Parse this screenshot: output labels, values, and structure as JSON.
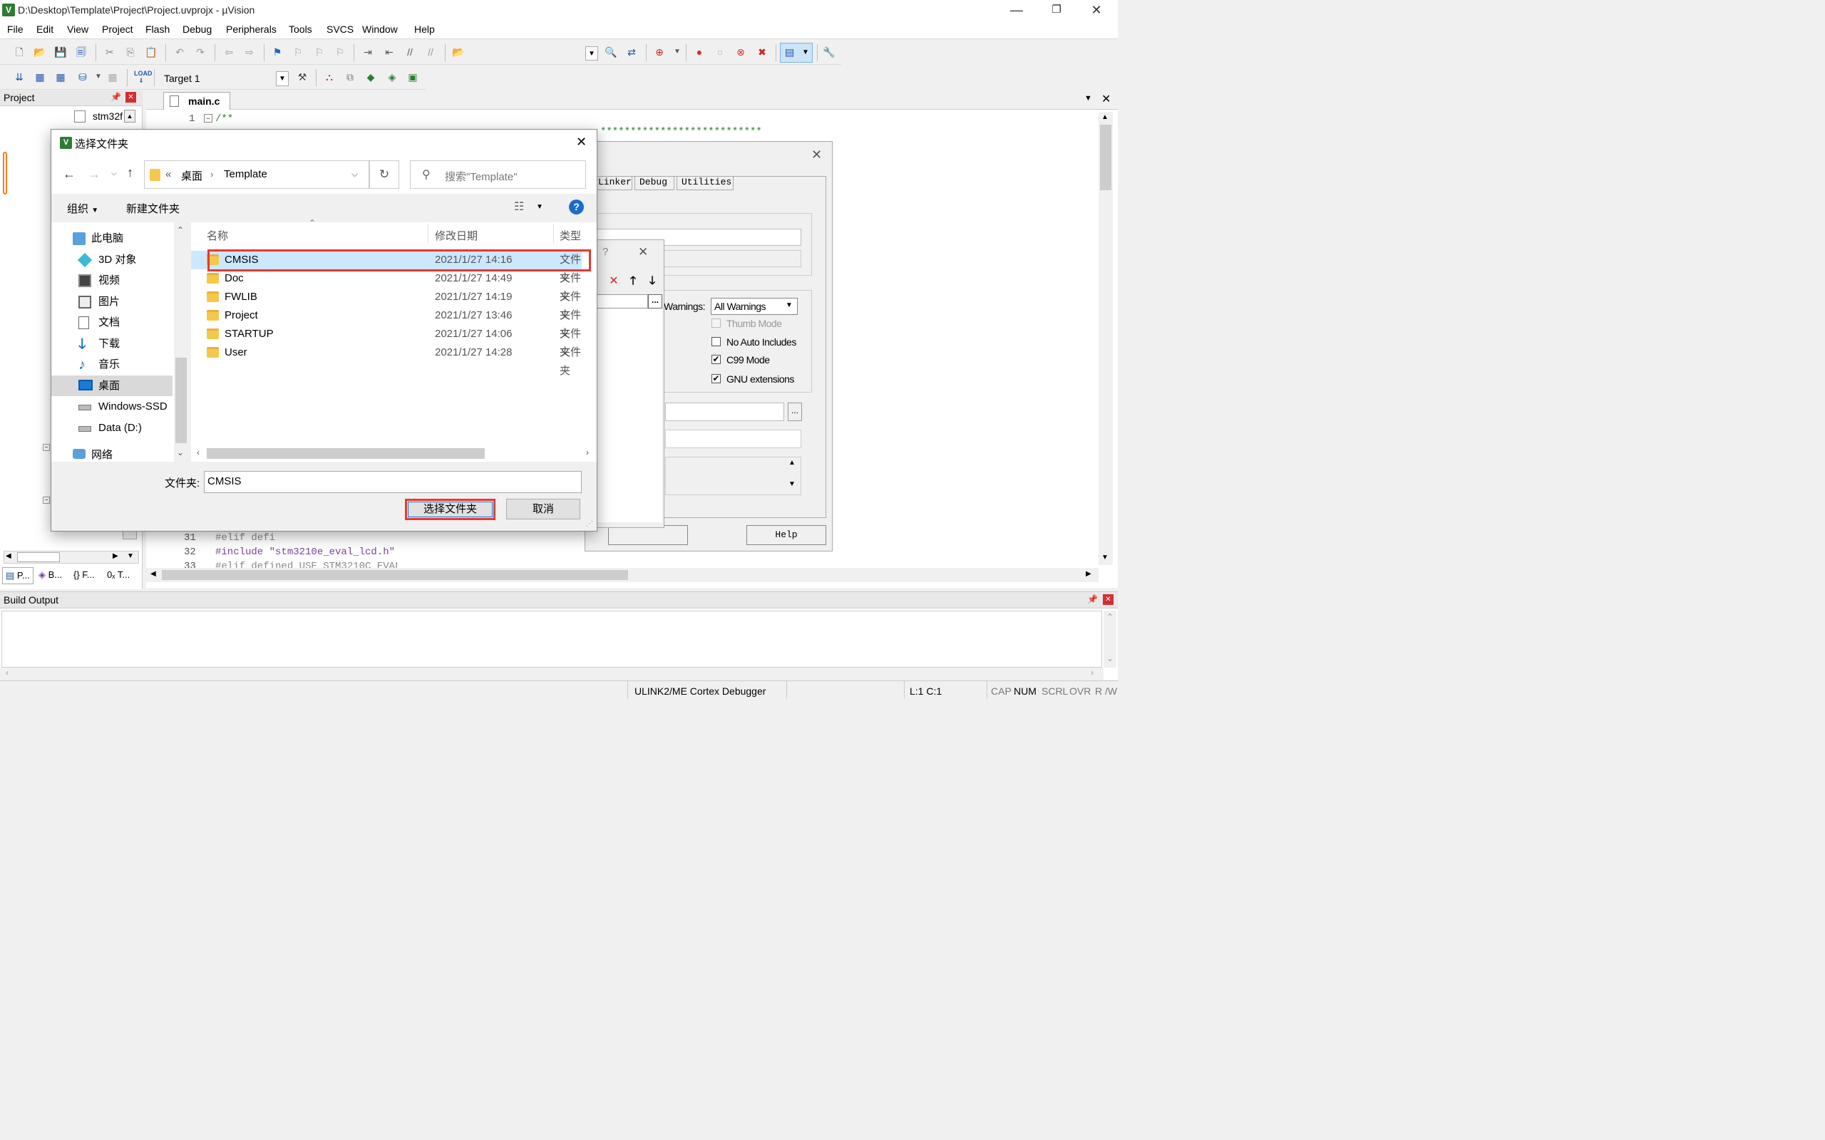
{
  "window": {
    "title": "D:\\Desktop\\Template\\Project\\Project.uvprojx - µVision",
    "app_icon": "V",
    "minimize": "—",
    "restore": "❐",
    "close": "✕"
  },
  "menu": [
    "File",
    "Edit",
    "View",
    "Project",
    "Flash",
    "Debug",
    "Peripherals",
    "Tools",
    "SVCS",
    "Window",
    "Help"
  ],
  "toolbar": {
    "target": "Target 1"
  },
  "project_panel": {
    "title": "Project",
    "tree_item": "stm32f",
    "bottom_tabs": [
      "P...",
      "B...",
      "{} F...",
      "0ₓ T..."
    ]
  },
  "editor": {
    "tab": "main.c",
    "lines": [
      {
        "num": "1",
        "code": "/**"
      },
      {
        "num": "31",
        "code": "#elif defi"
      },
      {
        "num": "32",
        "code": " #include \"stm3210e_eval_lcd.h\""
      },
      {
        "num": "33",
        "code": "#elif defined USE_STM3210C_EVAL"
      }
    ],
    "stars": "***************************"
  },
  "options_dialog": {
    "tabs": [
      "Linker",
      "Debug",
      "Utilities"
    ],
    "warnings_label": "Warnings:",
    "warnings_value": "All Warnings",
    "checkboxes": [
      {
        "label": "Thumb Mode",
        "checked": false,
        "disabled": true
      },
      {
        "label": "No Auto Includes",
        "checked": false,
        "disabled": false
      },
      {
        "label": "C99 Mode",
        "checked": true,
        "disabled": false
      },
      {
        "label": "GNU extensions",
        "checked": true,
        "disabled": false
      }
    ],
    "browse": "...",
    "help_button": "Help",
    "close": "✕"
  },
  "inner_dialog": {
    "question": "?",
    "close": "✕",
    "browse": "..."
  },
  "file_dialog": {
    "title": "选择文件夹",
    "close": "✕",
    "breadcrumb": {
      "prefix": "«",
      "parts": [
        "桌面",
        "Template"
      ]
    },
    "search_placeholder": "搜索\"Template\"",
    "organize": "组织",
    "new_folder": "新建文件夹",
    "nav": [
      {
        "label": "此电脑",
        "icon": "pc-icon",
        "indent": 0
      },
      {
        "label": "3D 对象",
        "icon": "cube-icon",
        "indent": 1
      },
      {
        "label": "视频",
        "icon": "video-icon",
        "indent": 1
      },
      {
        "label": "图片",
        "icon": "picture-icon",
        "indent": 1
      },
      {
        "label": "文档",
        "icon": "document-icon",
        "indent": 1
      },
      {
        "label": "下载",
        "icon": "download-icon",
        "indent": 1
      },
      {
        "label": "音乐",
        "icon": "music-icon",
        "indent": 1
      },
      {
        "label": "桌面",
        "icon": "desktop-icon",
        "indent": 1,
        "selected": true
      },
      {
        "label": "Windows-SSD",
        "icon": "drive-icon",
        "indent": 1
      },
      {
        "label": "Data (D:)",
        "icon": "drive-icon",
        "indent": 1
      },
      {
        "label": "网络",
        "icon": "network-icon",
        "indent": 0
      }
    ],
    "columns": [
      "名称",
      "修改日期",
      "类型"
    ],
    "files": [
      {
        "name": "CMSIS",
        "date": "2021/1/27 14:16",
        "type": "文件夹",
        "selected": true
      },
      {
        "name": "Doc",
        "date": "2021/1/27 14:49",
        "type": "文件夹"
      },
      {
        "name": "FWLIB",
        "date": "2021/1/27 14:19",
        "type": "文件夹"
      },
      {
        "name": "Project",
        "date": "2021/1/27 13:46",
        "type": "文件夹"
      },
      {
        "name": "STARTUP",
        "date": "2021/1/27 14:06",
        "type": "文件夹"
      },
      {
        "name": "User",
        "date": "2021/1/27 14:28",
        "type": "文件夹"
      }
    ],
    "folder_label": "文件夹:",
    "folder_value": "CMSIS",
    "select_button": "选择文件夹",
    "cancel_button": "取消",
    "help": "?"
  },
  "build_output": {
    "title": "Build Output"
  },
  "status": {
    "debugger": "ULINK2/ME Cortex Debugger",
    "position": "L:1 C:1",
    "caps": "CAP",
    "num": "NUM",
    "scrl": "SCRL",
    "ovr": "OVR",
    "rw": "R /W"
  },
  "colors": {
    "highlight": "#cce8ff",
    "annotation_red": "#e53935",
    "accent_blue": "#0066cc"
  }
}
